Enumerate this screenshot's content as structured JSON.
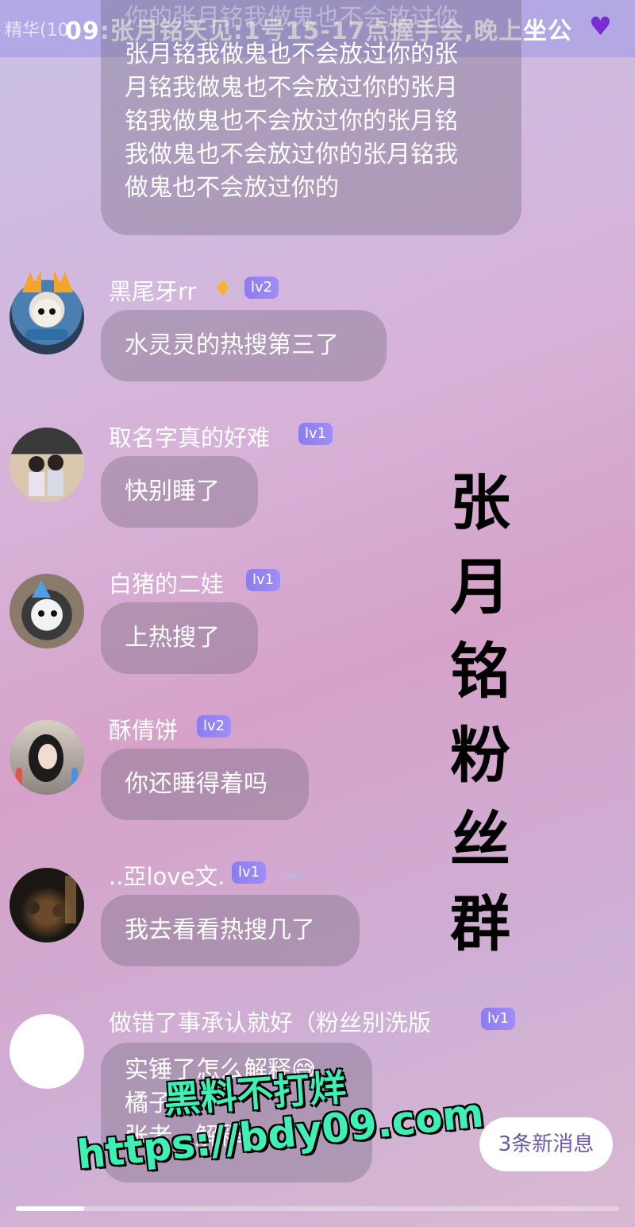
{
  "banner": {
    "pinned_label": "精华(10",
    "pinned_text": "09:张月铭天见:1号15-17点握手会,晚上坐公",
    "heart": "♥"
  },
  "top_message": {
    "ghost_line": "你的张月铭我做鬼也不会放过你",
    "lines": [
      "张月铭我做鬼也不会放过你的张",
      "月铭我做鬼也不会放过你的张月",
      "铭我做鬼也不会放过你的张月铭",
      "我做鬼也不会放过你的张月铭我",
      "做鬼也不会放过你的"
    ]
  },
  "messages": [
    {
      "name": "黑尾牙rr",
      "badge": "♦",
      "level": "lv2",
      "text": "水灵灵的热搜第三了"
    },
    {
      "name": "取名字真的好难",
      "level": "lv1",
      "text": "快别睡了"
    },
    {
      "name": "白猪的二娃",
      "level": "lv1",
      "text": "上热搜了"
    },
    {
      "name": "酥倩饼",
      "level": "lv2",
      "text": "你还睡得着吗"
    },
    {
      "name": "..亞love文.",
      "level": "lv1",
      "text": "我去看看热搜几了"
    },
    {
      "name": "做错了事承认就好（粉丝别洗版",
      "level": "lv1",
      "lines": [
        "实锤了怎么解释😅",
        "橘子...",
        "张老...解释。"
      ]
    }
  ],
  "side_title": "张\n月\n铭\n粉\n丝\n群",
  "watermark": {
    "line1": "黑料不打烊",
    "line2": "https://bdy09.com"
  },
  "new_messages_button": "3条新消息",
  "colors": {
    "banner": "#aaa0e6",
    "level_badge": "#8b7cf0",
    "watermark": "#3df0b5",
    "new_msg_text": "#6b5aa6"
  }
}
